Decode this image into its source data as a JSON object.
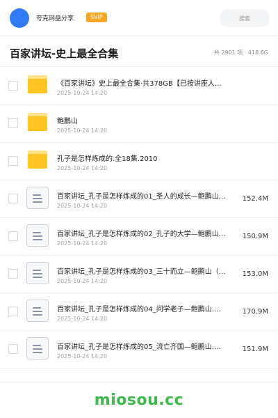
{
  "header": {
    "user_name": "夸克网盘分享",
    "badge": "SVIP",
    "search_placeholder": "搜索",
    "accent_color": "#2f7bf5",
    "badge_color": "#f5a623"
  },
  "page": {
    "title": "百家讲坛-史上最全合集",
    "summary": "共 2901 项 · 418.6G"
  },
  "items": [
    {
      "type": "folder",
      "icon": "folder-icon",
      "name": "《百家讲坛》史上最全合集·共378GB【已按讲座人…",
      "date": "2025-10-24 14:20",
      "size": ""
    },
    {
      "type": "folder",
      "icon": "folder-icon",
      "name": "鲍鹏山",
      "date": "2025-10-24 14:20",
      "size": ""
    },
    {
      "type": "folder",
      "icon": "folder-icon",
      "name": "孔子是怎样炼成的.全18集.2010",
      "date": "2025-10-24 14:20",
      "size": ""
    },
    {
      "type": "file",
      "icon": "document-icon",
      "name": "百家讲坛_孔子是怎样炼成的01_圣人的成长—鲍鹏山…",
      "date": "2025-10-24 14:20",
      "size": "152.4M"
    },
    {
      "type": "file",
      "icon": "document-icon",
      "name": "百家讲坛_孔子是怎样炼成的02_孔子的大学—鲍鹏山…",
      "date": "2025-10-24 14:20",
      "size": "150.9M"
    },
    {
      "type": "file",
      "icon": "document-icon",
      "name": "百家讲坛_孔子是怎样炼成的03_三十而立—鲍鹏山（…",
      "date": "2025-10-24 14:20",
      "size": "153.0M"
    },
    {
      "type": "file",
      "icon": "document-icon",
      "name": "百家讲坛_孔子是怎样炼成的04_问学老子—鲍鹏山.…",
      "date": "2025-10-24 14:20",
      "size": "170.9M"
    },
    {
      "type": "file",
      "icon": "document-icon",
      "name": "百家讲坛_孔子是怎样炼成的05_流亡齐国—鲍鹏山.…",
      "date": "2025-10-24 14:20",
      "size": "151.9M"
    }
  ],
  "footer": {
    "brand": "miosou.cc",
    "brand_color": "#3aba4a"
  }
}
